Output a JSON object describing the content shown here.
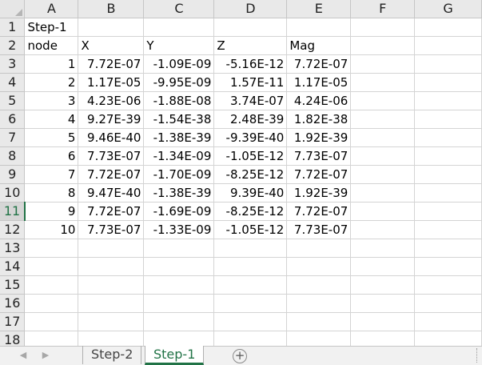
{
  "columns": [
    "A",
    "B",
    "C",
    "D",
    "E",
    "F",
    "G"
  ],
  "row_numbers": [
    "1",
    "2",
    "3",
    "4",
    "5",
    "6",
    "7",
    "8",
    "9",
    "10",
    "11",
    "12",
    "13",
    "14",
    "15",
    "16",
    "17",
    "18"
  ],
  "rows": [
    [
      "Step-1",
      "",
      "",
      "",
      "",
      "",
      ""
    ],
    [
      "node",
      "X",
      "Y",
      "Z",
      "Mag",
      "",
      ""
    ],
    [
      "1",
      "7.72E-07",
      "-1.09E-09",
      "-5.16E-12",
      "7.72E-07",
      "",
      ""
    ],
    [
      "2",
      "1.17E-05",
      "-9.95E-09",
      "1.57E-11",
      "1.17E-05",
      "",
      ""
    ],
    [
      "3",
      "4.23E-06",
      "-1.88E-08",
      "3.74E-07",
      "4.24E-06",
      "",
      ""
    ],
    [
      "4",
      "9.27E-39",
      "-1.54E-38",
      "2.48E-39",
      "1.82E-38",
      "",
      ""
    ],
    [
      "5",
      "9.46E-40",
      "-1.38E-39",
      "-9.39E-40",
      "1.92E-39",
      "",
      ""
    ],
    [
      "6",
      "7.73E-07",
      "-1.34E-09",
      "-1.05E-12",
      "7.73E-07",
      "",
      ""
    ],
    [
      "7",
      "7.72E-07",
      "-1.70E-09",
      "-8.25E-12",
      "7.72E-07",
      "",
      ""
    ],
    [
      "8",
      "9.47E-40",
      "-1.38E-39",
      "9.39E-40",
      "1.92E-39",
      "",
      ""
    ],
    [
      "9",
      "7.72E-07",
      "-1.69E-09",
      "-8.25E-12",
      "7.72E-07",
      "",
      ""
    ],
    [
      "10",
      "7.73E-07",
      "-1.33E-09",
      "-1.05E-12",
      "7.73E-07",
      "",
      ""
    ],
    [
      "",
      "",
      "",
      "",
      "",
      "",
      ""
    ],
    [
      "",
      "",
      "",
      "",
      "",
      "",
      ""
    ],
    [
      "",
      "",
      "",
      "",
      "",
      "",
      ""
    ],
    [
      "",
      "",
      "",
      "",
      "",
      "",
      ""
    ],
    [
      "",
      "",
      "",
      "",
      "",
      "",
      ""
    ],
    [
      "",
      "",
      "",
      "",
      "",
      "",
      ""
    ]
  ],
  "active_row": "11",
  "sheet_tabs": [
    {
      "label": "Step-2",
      "active": false
    },
    {
      "label": "Step-1",
      "active": true
    }
  ],
  "add_sheet_symbol": "+",
  "nav": {
    "prev": "◀",
    "next": "▶"
  },
  "colors": {
    "accent": "#217346",
    "header_bg": "#e9e9e9",
    "gridline": "#d4d4d4"
  }
}
